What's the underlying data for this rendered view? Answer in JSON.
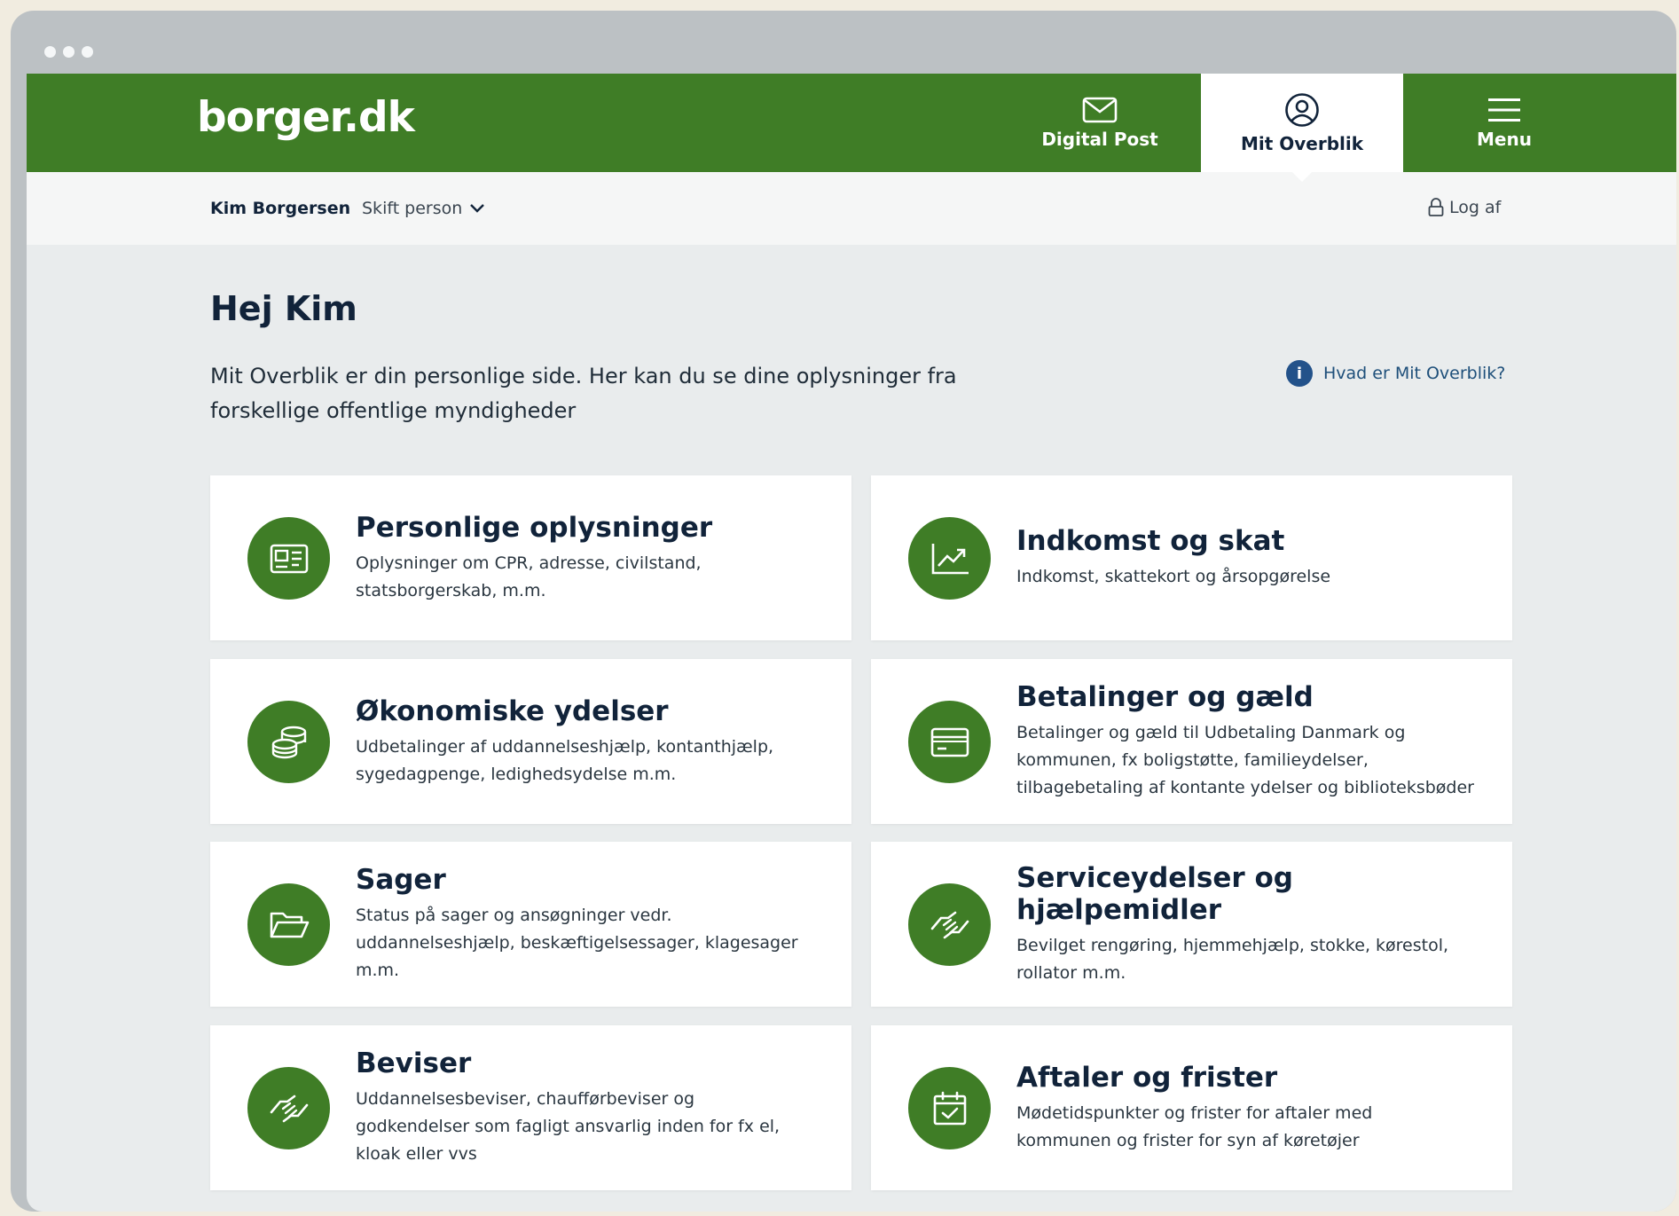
{
  "window": {
    "controls": [
      "close",
      "minimize",
      "maximize"
    ]
  },
  "header": {
    "logo": "borger.dk",
    "nav": [
      {
        "label": "Digital Post",
        "icon": "envelope-icon",
        "active": false
      },
      {
        "label": "Mit Overblik",
        "icon": "user-circle-icon",
        "active": true
      },
      {
        "label": "Menu",
        "icon": "hamburger-icon",
        "active": false
      }
    ]
  },
  "userbar": {
    "name": "Kim Borgersen",
    "switch_label": "Skift person",
    "logout_label": "Log af"
  },
  "main": {
    "greeting": "Hej Kim",
    "intro_line1": "Mit Overblik er din personlige side. Her kan du se dine oplysninger fra",
    "intro_line2": "forskellige offentlige myndigheder",
    "help_label": "Hvad er Mit Overblik?",
    "cards": [
      {
        "title": "Personlige oplysninger",
        "desc_lines": [
          "Oplysninger om CPR, adresse, civilstand,",
          "statsborgerskab, m.m."
        ],
        "icon": "id-card-icon"
      },
      {
        "title": "Indkomst og skat",
        "desc_lines": [
          "Indkomst, skattekort og årsopgørelse"
        ],
        "icon": "chart-trend-icon"
      },
      {
        "title": "Økonomiske ydelser",
        "desc_lines": [
          "Udbetalinger af uddannelseshjælp, kontanthjælp,",
          "sygedagpenge, ledighedsydelse m.m."
        ],
        "icon": "coins-stack-icon"
      },
      {
        "title": "Betalinger og gæld",
        "desc_lines": [
          "Betalinger og gæld til Udbetaling Danmark og",
          "kommunen, fx boligstøtte, familieydelser,",
          "tilbagebetaling af kontante ydelser og biblioteksbøder"
        ],
        "icon": "credit-card-icon"
      },
      {
        "title": "Sager",
        "desc_lines": [
          "Status på sager og ansøgninger vedr.",
          "uddannelseshjælp, beskæftigelsessager, klagesager",
          "m.m."
        ],
        "icon": "folder-open-icon"
      },
      {
        "title": "Serviceydelser og hjælpemidler",
        "desc_lines": [
          "Bevilget rengøring, hjemmehjælp, stokke, kørestol,",
          "rollator m.m."
        ],
        "icon": "handshake-icon"
      },
      {
        "title": "Beviser",
        "desc_lines": [
          "Uddannelsesbeviser, chaufførbeviser og",
          "godkendelser som fagligt ansvarlig inden for fx el,",
          "kloak eller vvs"
        ],
        "icon": "handshake-icon"
      },
      {
        "title": "Aftaler og frister",
        "desc_lines": [
          "Mødetidspunkter og frister for aftaler med",
          "kommunen og frister for syn af køretøjer"
        ],
        "icon": "calendar-check-icon"
      }
    ]
  },
  "colors": {
    "brand_green": "#3f7d26",
    "heading_navy": "#11233a",
    "link_blue": "#1e4f7a",
    "page_bg": "#e9eced"
  }
}
